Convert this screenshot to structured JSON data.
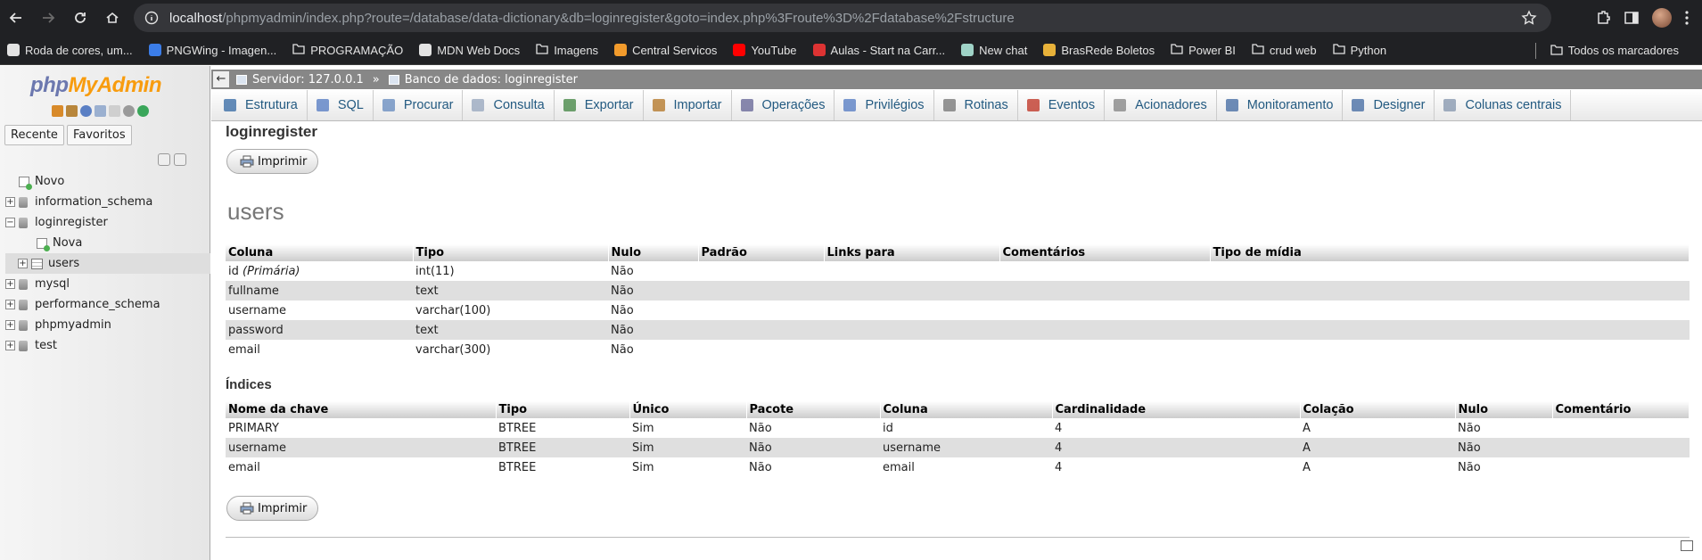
{
  "browser": {
    "url_host": "localhost",
    "url_path": "/phpmyadmin/index.php?route=/database/data-dictionary&db=loginregister&goto=index.php%3Froute%3D%2Fdatabase%2Fstructure",
    "bookmarks": [
      {
        "label": "Roda de cores, um...",
        "icon": "color-wheel-icon"
      },
      {
        "label": "PNGWing - Imagen...",
        "icon": "pngwing-icon"
      },
      {
        "label": "PROGRAMAÇÃO",
        "icon": "folder-icon"
      },
      {
        "label": "MDN Web Docs",
        "icon": "mdn-icon"
      },
      {
        "label": "Imagens",
        "icon": "folder-icon"
      },
      {
        "label": "Central Servicos",
        "icon": "d-icon"
      },
      {
        "label": "YouTube",
        "icon": "youtube-icon"
      },
      {
        "label": "Aulas - Start na Carr...",
        "icon": "start-icon"
      },
      {
        "label": "New chat",
        "icon": "chatgpt-icon"
      },
      {
        "label": "BrasRede Boletos",
        "icon": "brasrede-icon"
      },
      {
        "label": "Power BI",
        "icon": "folder-icon"
      },
      {
        "label": "crud web",
        "icon": "folder-icon"
      },
      {
        "label": "Python",
        "icon": "folder-icon"
      }
    ],
    "all_bookmarks": "Todos os marcadores"
  },
  "sidebar": {
    "logo_php": "php",
    "logo_myadmin": "MyAdmin",
    "tabs": [
      "Recente",
      "Favoritos"
    ],
    "tree": {
      "new": "Novo",
      "databases": [
        {
          "name": "information_schema"
        },
        {
          "name": "loginregister"
        },
        {
          "name": "mysql"
        },
        {
          "name": "performance_schema"
        },
        {
          "name": "phpmyadmin"
        },
        {
          "name": "test"
        }
      ],
      "sub_new": "Nova",
      "sub_table": "users"
    }
  },
  "serverbar": {
    "server": "Servidor: 127.0.0.1",
    "separator": "»",
    "database": "Banco de dados: loginregister"
  },
  "topmenu": [
    "Estrutura",
    "SQL",
    "Procurar",
    "Consulta",
    "Exportar",
    "Importar",
    "Operações",
    "Privilégios",
    "Rotinas",
    "Eventos",
    "Acionadores",
    "Monitoramento",
    "Designer",
    "Colunas centrais"
  ],
  "main": {
    "db_title": "loginregister",
    "print_label": "Imprimir",
    "table_name": "users",
    "columns_headers": [
      "Coluna",
      "Tipo",
      "Nulo",
      "Padrão",
      "Links para",
      "Comentários",
      "Tipo de mídia"
    ],
    "columns": [
      {
        "name": "id",
        "note": "(Primária)",
        "type": "int(11)",
        "null": "Não"
      },
      {
        "name": "fullname",
        "note": "",
        "type": "text",
        "null": "Não"
      },
      {
        "name": "username",
        "note": "",
        "type": "varchar(100)",
        "null": "Não"
      },
      {
        "name": "password",
        "note": "",
        "type": "text",
        "null": "Não"
      },
      {
        "name": "email",
        "note": "",
        "type": "varchar(300)",
        "null": "Não"
      }
    ],
    "indexes_title": "Índices",
    "index_headers": [
      "Nome da chave",
      "Tipo",
      "Único",
      "Pacote",
      "Coluna",
      "Cardinalidade",
      "Colação",
      "Nulo",
      "Comentário"
    ],
    "indexes": [
      {
        "key": "PRIMARY",
        "type": "BTREE",
        "unique": "Sim",
        "packed": "Não",
        "column": "id",
        "cardinality": "4",
        "collation": "A",
        "null": "Não"
      },
      {
        "key": "username",
        "type": "BTREE",
        "unique": "Sim",
        "packed": "Não",
        "column": "username",
        "cardinality": "4",
        "collation": "A",
        "null": "Não"
      },
      {
        "key": "email",
        "type": "BTREE",
        "unique": "Sim",
        "packed": "Não",
        "column": "email",
        "cardinality": "4",
        "collation": "A",
        "null": "Não"
      }
    ]
  },
  "colors": {
    "link": "#235a81",
    "logo_php": "#6c78af",
    "logo_myadmin": "#f89c0e"
  }
}
